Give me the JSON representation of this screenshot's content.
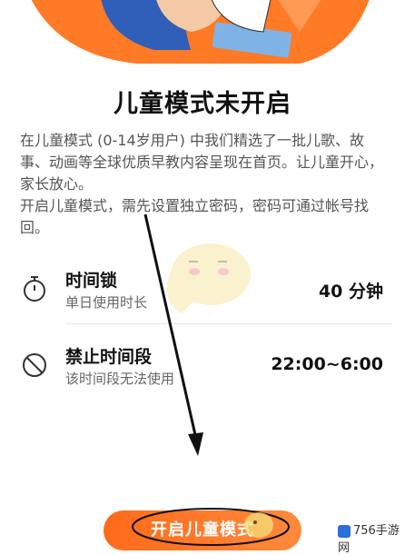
{
  "title": "儿童模式未开启",
  "description": [
    "在儿童模式 (0-14岁用户) 中我们精选了一批儿歌、故事、动画等全球优质早教内容呈现在首页。让儿童开心，家长放心。",
    "开启儿童模式，需先设置独立密码，密码可通过帐号找回。"
  ],
  "settings": [
    {
      "label": "时间锁",
      "sub": "单日使用时长",
      "value": "40 分钟",
      "icon": "stopwatch-icon"
    },
    {
      "label": "禁止时间段",
      "sub": "该时间段无法使用",
      "value": "22:00~6:00",
      "icon": "prohibited-icon"
    }
  ],
  "button": {
    "label": "开启儿童模式"
  },
  "watermark": {
    "text": "756手游网"
  },
  "colors": {
    "accent": "#ff7a26",
    "text": "#111111",
    "subtext": "#666666"
  }
}
